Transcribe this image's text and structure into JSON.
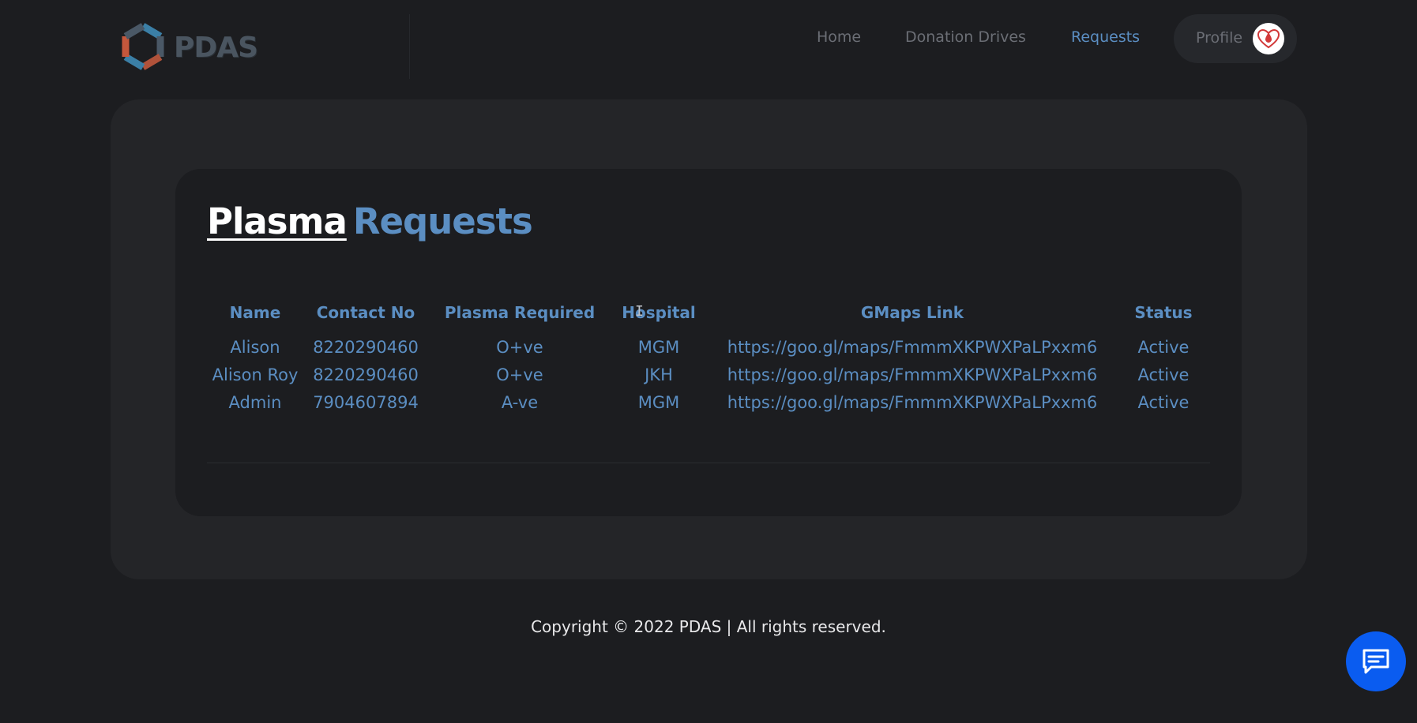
{
  "brand": {
    "logo_text": "PDAS"
  },
  "nav": {
    "items": [
      {
        "label": "Home"
      },
      {
        "label": "Donation Drives"
      },
      {
        "label": "Requests"
      }
    ],
    "active": "Requests",
    "profile_label": "Profile"
  },
  "page": {
    "title_part1": "Plasma",
    "title_part2": "Requests"
  },
  "table": {
    "headers": [
      "Name",
      "Contact No",
      "Plasma Required",
      "Hospital",
      "GMaps Link",
      "Status"
    ],
    "rows": [
      [
        "Alison",
        "8220290460",
        "O+ve",
        "MGM",
        "https://goo.gl/maps/FmmmXKPWXPaLPxxm6",
        "Active"
      ],
      [
        "Alison Roy",
        "8220290460",
        "O+ve",
        "JKH",
        "https://goo.gl/maps/FmmmXKPWXPaLPxxm6",
        "Active"
      ],
      [
        "Admin",
        "7904607894",
        "A-ve",
        "MGM",
        "https://goo.gl/maps/FmmmXKPWXPaLPxxm6",
        "Active"
      ]
    ]
  },
  "footer": {
    "copyright": "Copyright © 2022 PDAS | All rights reserved."
  },
  "colors": {
    "background": "#1c1d20",
    "panel": "#242528",
    "accent": "#5b8ec2",
    "chat_button": "#0a5cf0"
  },
  "icons": {
    "chat": "chat-bubble-icon",
    "logo": "pdas-hexagon-logo",
    "avatar": "blood-drop-heart-avatar"
  }
}
